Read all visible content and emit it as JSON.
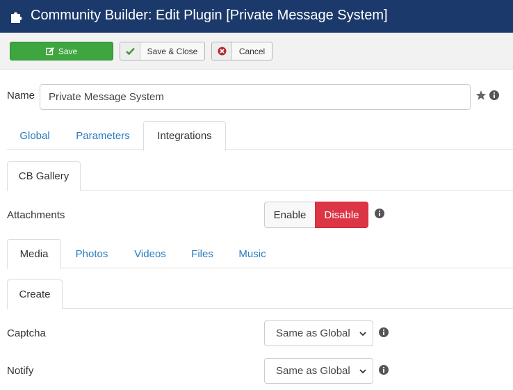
{
  "header": {
    "title": "Community Builder: Edit Plugin [Private Message System]"
  },
  "toolbar": {
    "save_label": "Save",
    "save_close_label": "Save & Close",
    "cancel_label": "Cancel"
  },
  "name_field": {
    "label": "Name",
    "value": "Private Message System"
  },
  "main_tabs": [
    {
      "label": "Global"
    },
    {
      "label": "Parameters"
    },
    {
      "label": "Integrations"
    }
  ],
  "integration_tabs": [
    {
      "label": "CB Gallery"
    }
  ],
  "attachments": {
    "label": "Attachments",
    "enable_label": "Enable",
    "disable_label": "Disable",
    "selected": "Disable"
  },
  "media_tabs": [
    {
      "label": "Media"
    },
    {
      "label": "Photos"
    },
    {
      "label": "Videos"
    },
    {
      "label": "Files"
    },
    {
      "label": "Music"
    }
  ],
  "create_tabs": [
    {
      "label": "Create"
    }
  ],
  "captcha": {
    "label": "Captcha",
    "value": "Same as Global"
  },
  "notify": {
    "label": "Notify",
    "value": "Same as Global"
  },
  "colors": {
    "header": "#1b3a6b",
    "save": "#3ea63f",
    "disable": "#dc3545",
    "link": "#2a7bbf"
  }
}
